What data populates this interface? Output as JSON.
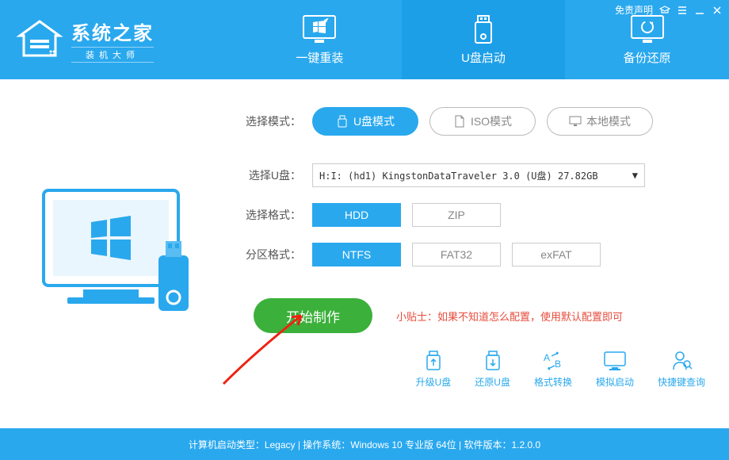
{
  "header": {
    "logo_title": "系统之家",
    "logo_sub": "装机大师",
    "disclaimer": "免责声明",
    "tabs": [
      {
        "label": "一键重装"
      },
      {
        "label": "U盘启动"
      },
      {
        "label": "备份还原"
      }
    ]
  },
  "modes": {
    "label": "选择模式：",
    "usb": "U盘模式",
    "iso": "ISO模式",
    "local": "本地模式"
  },
  "usb_select": {
    "label": "选择U盘：",
    "value": "H:I: (hd1) KingstonDataTraveler 3.0 (U盘) 27.82GB"
  },
  "format": {
    "label": "选择格式：",
    "hdd": "HDD",
    "zip": "ZIP"
  },
  "partition": {
    "label": "分区格式：",
    "ntfs": "NTFS",
    "fat32": "FAT32",
    "exfat": "exFAT"
  },
  "start": {
    "button": "开始制作",
    "tip": "小贴士：如果不知道怎么配置，使用默认配置即可"
  },
  "tools": {
    "upgrade": "升级U盘",
    "restore": "还原U盘",
    "convert": "格式转换",
    "simulate": "模拟启动",
    "hotkey": "快捷键查询"
  },
  "footer": "计算机启动类型：Legacy | 操作系统：Windows 10 专业版 64位 | 软件版本：1.2.0.0"
}
